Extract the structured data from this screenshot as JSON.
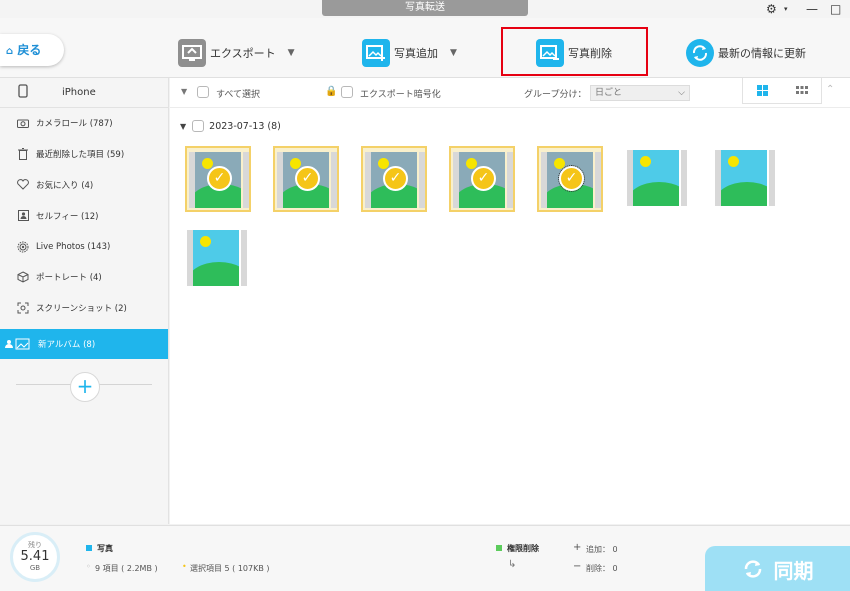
{
  "window": {
    "title": "写真転送",
    "settings_icon": "gear-icon",
    "minimize": "—",
    "maximize": "□"
  },
  "toolbar": {
    "back_label": "戻る",
    "export_label": "エクスポート",
    "add_label": "写真追加",
    "delete_label": "写真削除",
    "refresh_label": "最新の情報に更新"
  },
  "sidebar": {
    "device": "iPhone",
    "items": [
      {
        "label": "カメラロール (787)",
        "icon": "camera-icon"
      },
      {
        "label": "最近削除した項目 (59)",
        "icon": "trash-icon"
      },
      {
        "label": "お気に入り (4)",
        "icon": "heart-icon"
      },
      {
        "label": "セルフィー (12)",
        "icon": "selfie-icon"
      },
      {
        "label": "Live Photos (143)",
        "icon": "live-photo-icon"
      },
      {
        "label": "ポートレート (4)",
        "icon": "portrait-icon"
      },
      {
        "label": "スクリーンショット (2)",
        "icon": "screenshot-icon"
      }
    ],
    "active_item": "新アルバム (8)",
    "add_label": "+"
  },
  "main": {
    "select_all": "すべて選択",
    "encrypt": "エクスポート暗号化",
    "group_label": "グループ分け：",
    "group_value": "日ごと",
    "date_group": "2023-07-13  (8)"
  },
  "footer": {
    "remaining_label": "残り",
    "remaining_value": "5.41",
    "remaining_unit": "GB",
    "category": "写真",
    "items_info": "9 項目 ( 2.2MB )",
    "selected_info": "選択項目 5 ( 107KB )",
    "permission": "権限削除",
    "added": "追加： 0",
    "deleted": "削除： 0",
    "sync_label": "同期"
  },
  "colors": {
    "accent": "#1fb5ec",
    "highlight": "#e60012",
    "selection": "#f5c518"
  }
}
